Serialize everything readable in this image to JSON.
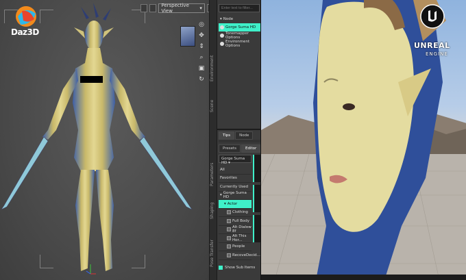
{
  "daz": {
    "logo_text": "Daz3D",
    "view_mode": "Perspective View",
    "scene_search_placeholder": "Enter text to filter...",
    "scene_items": [
      "Node",
      "Gorge Suma HD",
      "Tonemapper Options",
      "Environment Options"
    ],
    "vtabs": [
      "Environment",
      "Scene",
      "Parameters",
      "Shaping",
      "Pose Transfer"
    ],
    "tips_tabs": [
      "Tips",
      "Node"
    ],
    "content_tabs": [
      "Presets",
      "Editor"
    ],
    "figure_select": "Gorge Suma HD",
    "library_items": [
      "All",
      "Favorites",
      "Currently Used",
      "Gorge Suma HD",
      "Actor",
      "Clothing",
      "Full Body",
      "Alt Dialow 8f",
      "Alt This Hor...",
      "People",
      "RecoveDecid..."
    ],
    "show_sub_items": "Show Sub Items",
    "accent": "#3ff0c9"
  },
  "unreal": {
    "logo_line1": "UNREAL",
    "logo_line2": "ENGINE"
  }
}
